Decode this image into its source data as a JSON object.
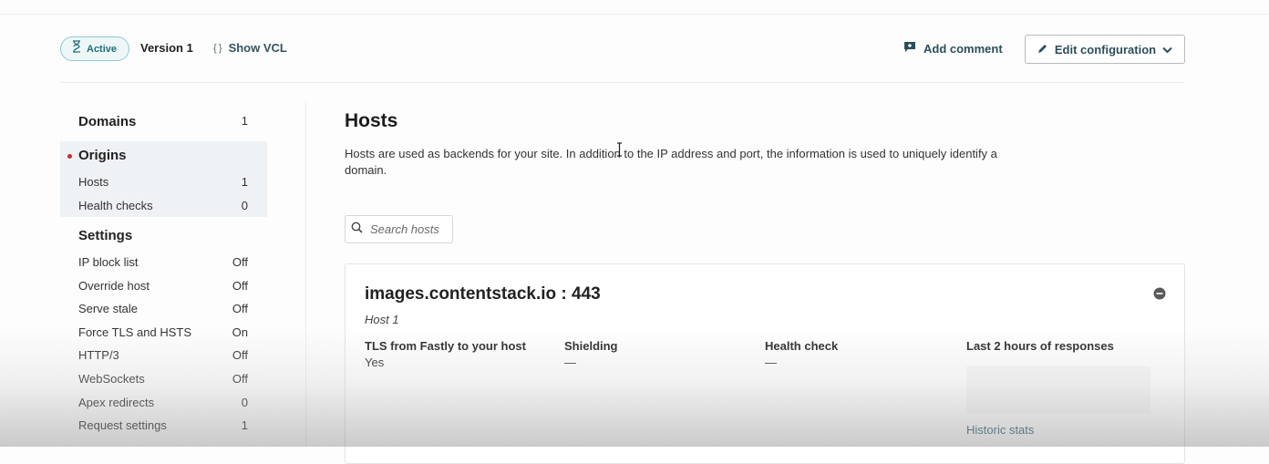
{
  "header": {
    "status": "Active",
    "version": "Version 1",
    "show_vcl": "Show VCL",
    "add_comment": "Add comment",
    "edit_configuration": "Edit configuration"
  },
  "sidebar": {
    "domains": {
      "label": "Domains",
      "count": "1"
    },
    "origins": {
      "label": "Origins"
    },
    "origin_items": [
      {
        "label": "Hosts",
        "value": "1"
      },
      {
        "label": "Health checks",
        "value": "0"
      }
    ],
    "settings": {
      "label": "Settings"
    },
    "settings_items": [
      {
        "label": "IP block list",
        "value": "Off"
      },
      {
        "label": "Override host",
        "value": "Off"
      },
      {
        "label": "Serve stale",
        "value": "Off"
      },
      {
        "label": "Force TLS and HSTS",
        "value": "On"
      },
      {
        "label": "HTTP/3",
        "value": "Off"
      },
      {
        "label": "WebSockets",
        "value": "Off"
      },
      {
        "label": "Apex redirects",
        "value": "0"
      },
      {
        "label": "Request settings",
        "value": "1"
      }
    ]
  },
  "main": {
    "title": "Hosts",
    "description": "Hosts are used as backends for your site. In addition to the IP address and port, the information is used to uniquely identify a domain.",
    "search_placeholder": "Search hosts",
    "host": {
      "name": "images.contentstack.io : 443",
      "subtitle": "Host 1",
      "columns": [
        {
          "label": "TLS from Fastly to your host",
          "value": "Yes"
        },
        {
          "label": "Shielding",
          "value": "—"
        },
        {
          "label": "Health check",
          "value": "—"
        },
        {
          "label": "Last 2 hours of responses",
          "value": ""
        }
      ],
      "historic_stats": "Historic stats"
    }
  },
  "colors": {
    "accent": "#1f6f79",
    "link": "#2b4f5a",
    "active_dot": "#c92a2a"
  }
}
